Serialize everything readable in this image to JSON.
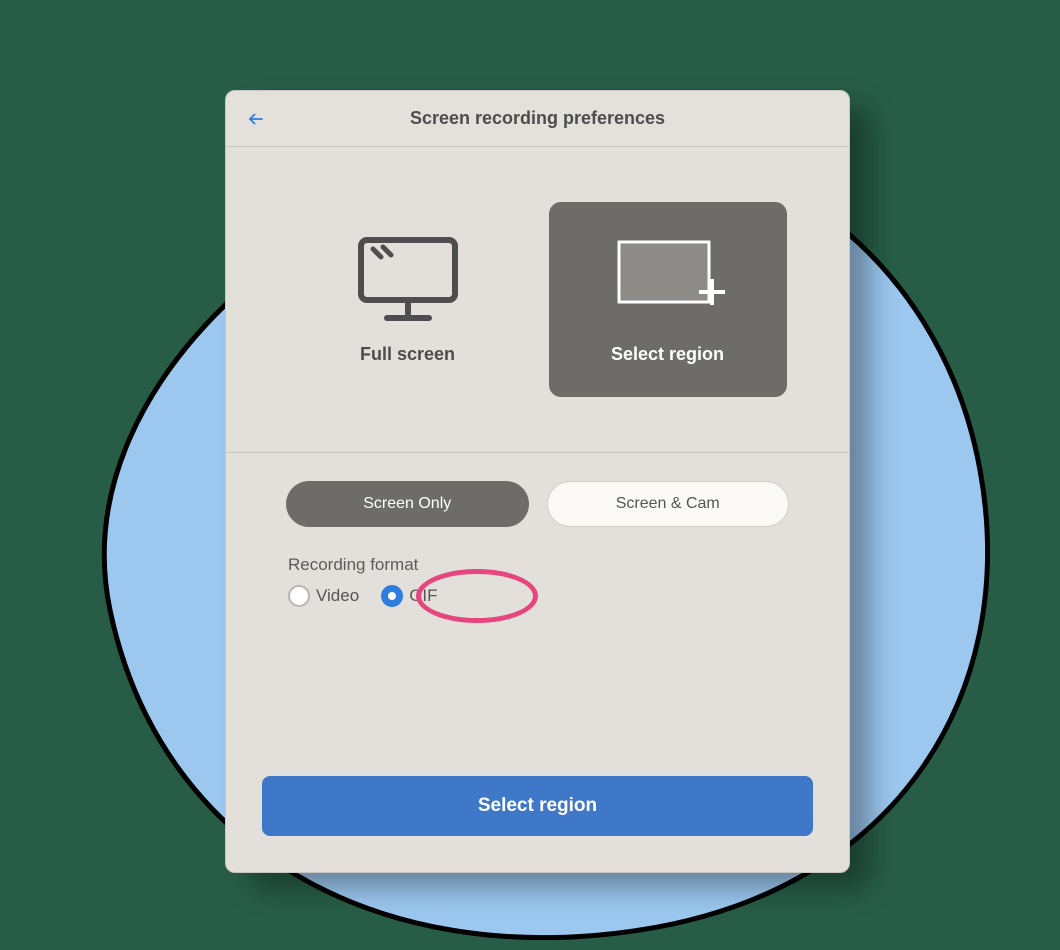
{
  "header": {
    "title": "Screen recording preferences"
  },
  "capture_modes": {
    "full_screen": {
      "label": "Full screen",
      "selected": false
    },
    "select_region": {
      "label": "Select region",
      "selected": true
    }
  },
  "source_options": {
    "screen_only": {
      "label": "Screen Only",
      "selected": true
    },
    "screen_and_cam": {
      "label": "Screen & Cam",
      "selected": false
    }
  },
  "format": {
    "section_label": "Recording format",
    "video": {
      "label": "Video",
      "selected": false
    },
    "gif": {
      "label": "GIF",
      "selected": true
    }
  },
  "primary_action": {
    "label": "Select region"
  },
  "colors": {
    "page_bg": "#275d47",
    "blob": "#9cc8f0",
    "panel_bg": "#e3e0db",
    "accent_blue": "#3f77c9",
    "radio_blue": "#2f7de0",
    "highlight_pink": "#e6457e",
    "dark_tile": "#6e6c69"
  },
  "annotation": {
    "gif_option_highlighted": true,
    "shape": "oval",
    "color": "#e6457e"
  }
}
